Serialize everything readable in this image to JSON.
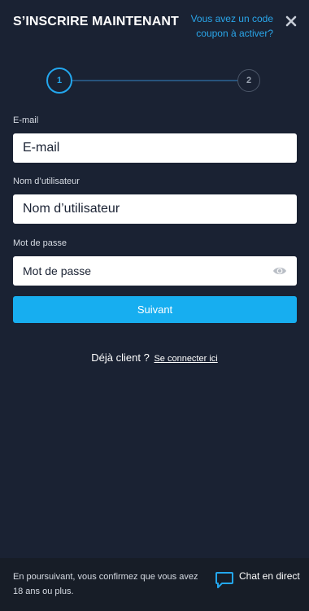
{
  "header": {
    "title": "S’INSCRIRE MAINTENANT",
    "coupon_link": "Vous avez un code coupon à activer?"
  },
  "stepper": {
    "step1": "1",
    "step2": "2"
  },
  "form": {
    "email_label": "E-mail",
    "email_placeholder": "E-mail",
    "username_label": "Nom d’utilisateur",
    "username_placeholder": "Nom d’utilisateur",
    "password_label": "Mot de passe",
    "password_placeholder": "Mot de passe",
    "submit_label": "Suivant"
  },
  "login": {
    "prompt": "Déjà client ?",
    "link": "Se connecter ici"
  },
  "footer": {
    "disclaimer": "En poursuivant, vous confirmez que vous avez 18 ans ou plus.",
    "chat_label": "Chat en direct"
  },
  "colors": {
    "background": "#1a2233",
    "accent": "#17aef0",
    "footer_bg": "#171d27"
  },
  "icons": {
    "close": "close-icon",
    "password_toggle": "eye-icon",
    "chat": "chat-bubble-icon"
  }
}
